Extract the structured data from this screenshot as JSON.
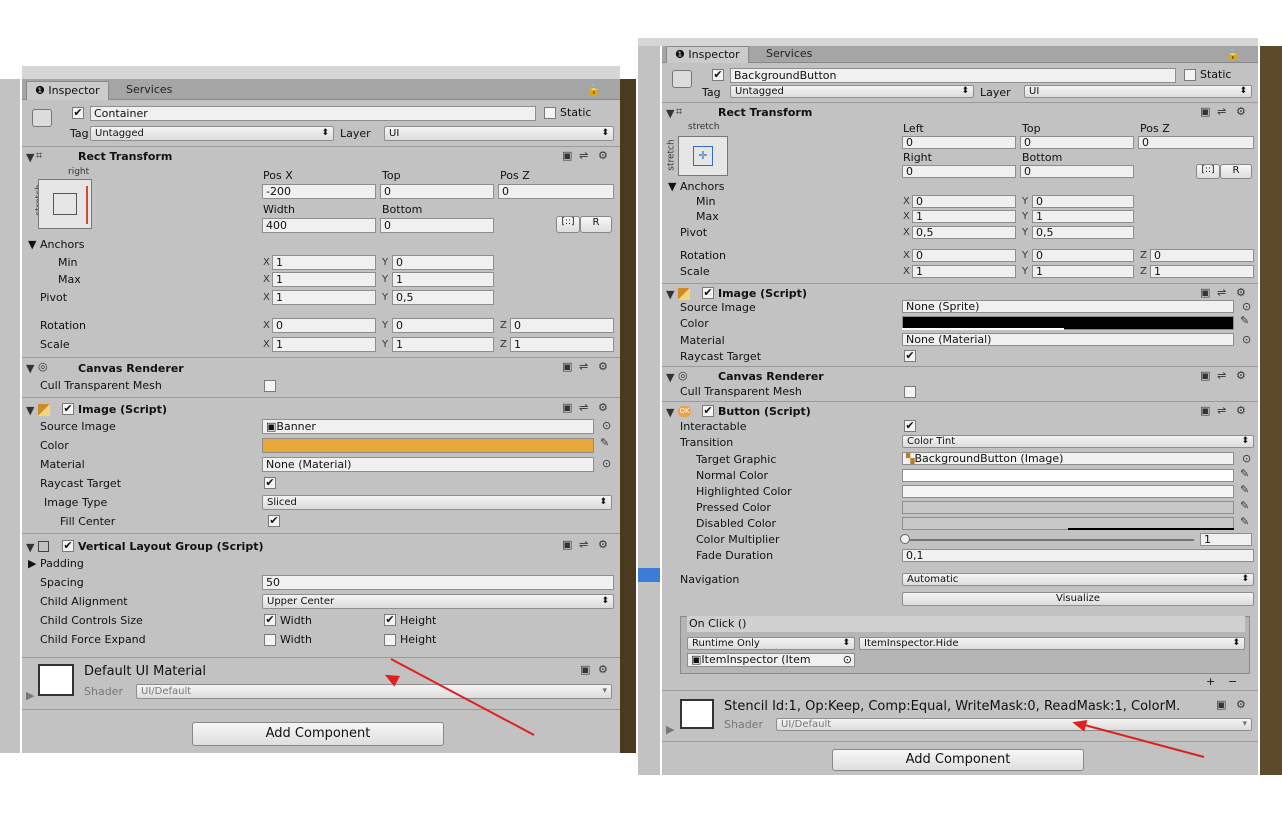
{
  "left": {
    "tabs": [
      "Inspector",
      "Services"
    ],
    "object_name": "Container",
    "static_label": "Static",
    "tag_label": "Tag",
    "tag_value": "Untagged",
    "layer_label": "Layer",
    "layer_value": "UI",
    "rect_transform": {
      "title": "Rect Transform",
      "anchor_h": "right",
      "anchor_v": "stretch",
      "labels": [
        "Pos X",
        "Top",
        "Pos Z",
        "Width",
        "Bottom"
      ],
      "values": [
        "-200",
        "0",
        "0",
        "400",
        "0"
      ],
      "r_button": "R",
      "anchors_label": "Anchors",
      "min_label": "Min",
      "max_label": "Max",
      "pivot_label": "Pivot",
      "rotation_label": "Rotation",
      "scale_label": "Scale",
      "min": [
        "1",
        "0"
      ],
      "max": [
        "1",
        "1"
      ],
      "pivot": [
        "1",
        "0,5"
      ],
      "rotation": [
        "0",
        "0",
        "0"
      ],
      "scale": [
        "1",
        "1",
        "1"
      ]
    },
    "canvas_renderer": {
      "title": "Canvas Renderer",
      "cull_label": "Cull Transparent Mesh"
    },
    "image": {
      "title": "Image (Script)",
      "source_label": "Source Image",
      "source_value": "Banner",
      "color_label": "Color",
      "color_value": "#e8a93a",
      "material_label": "Material",
      "material_value": "None (Material)",
      "raycast_label": "Raycast Target",
      "type_label": "Image Type",
      "type_value": "Sliced",
      "fill_label": "Fill Center"
    },
    "vlg": {
      "title": "Vertical Layout Group (Script)",
      "padding_label": "Padding",
      "spacing_label": "Spacing",
      "spacing_value": "50",
      "align_label": "Child Alignment",
      "align_value": "Upper Center",
      "controls_label": "Child Controls Size",
      "expand_label": "Child Force Expand",
      "width_label": "Width",
      "height_label": "Height"
    },
    "material": {
      "name": "Default UI Material",
      "shader_label": "Shader",
      "shader_value": "UI/Default"
    },
    "add_component": "Add Component"
  },
  "right": {
    "tabs": [
      "Inspector",
      "Services"
    ],
    "object_name": "BackgroundButton",
    "static_label": "Static",
    "tag_label": "Tag",
    "tag_value": "Untagged",
    "layer_label": "Layer",
    "layer_value": "UI",
    "rect_transform": {
      "title": "Rect Transform",
      "anchor_h": "stretch",
      "anchor_v": "stretch",
      "labels": [
        "Left",
        "Top",
        "Pos Z",
        "Right",
        "Bottom"
      ],
      "values": [
        "0",
        "0",
        "0",
        "0",
        "0"
      ],
      "r_button": "R",
      "anchors_label": "Anchors",
      "min_label": "Min",
      "max_label": "Max",
      "pivot_label": "Pivot",
      "rotation_label": "Rotation",
      "scale_label": "Scale",
      "min": [
        "0",
        "0"
      ],
      "max": [
        "1",
        "1"
      ],
      "pivot": [
        "0,5",
        "0,5"
      ],
      "rotation": [
        "0",
        "0",
        "0"
      ],
      "scale": [
        "1",
        "1",
        "1"
      ]
    },
    "image": {
      "title": "Image (Script)",
      "source_label": "Source Image",
      "source_value": "None (Sprite)",
      "color_label": "Color",
      "color_value": "#000000",
      "material_label": "Material",
      "material_value": "None (Material)",
      "raycast_label": "Raycast Target"
    },
    "canvas_renderer": {
      "title": "Canvas Renderer",
      "cull_label": "Cull Transparent Mesh"
    },
    "button": {
      "title": "Button (Script)",
      "interactable_label": "Interactable",
      "transition_label": "Transition",
      "transition_value": "Color Tint",
      "target_label": "Target Graphic",
      "target_value": "BackgroundButton (Image)",
      "normal_label": "Normal Color",
      "highlighted_label": "Highlighted Color",
      "pressed_label": "Pressed Color",
      "disabled_label": "Disabled Color",
      "multiplier_label": "Color Multiplier",
      "multiplier_value": "1",
      "fade_label": "Fade Duration",
      "fade_value": "0,1",
      "navigation_label": "Navigation",
      "navigation_value": "Automatic",
      "visualize_label": "Visualize",
      "onclick_label": "On Click ()",
      "runtime_value": "Runtime Only",
      "function_value": "ItemInspector.Hide",
      "object_value": "ItemInspector (Item",
      "plus": "+",
      "minus": "−"
    },
    "material": {
      "name": "Stencil Id:1, Op:Keep, Comp:Equal, WriteMask:0, ReadMask:1, ColorM.",
      "shader_label": "Shader",
      "shader_value": "UI/Default"
    },
    "add_component": "Add Component"
  },
  "colors": {
    "panel_bg": "#c2c2c2",
    "annotation_arrow": "#e02020",
    "selection_blue": "#3d7bd8"
  }
}
